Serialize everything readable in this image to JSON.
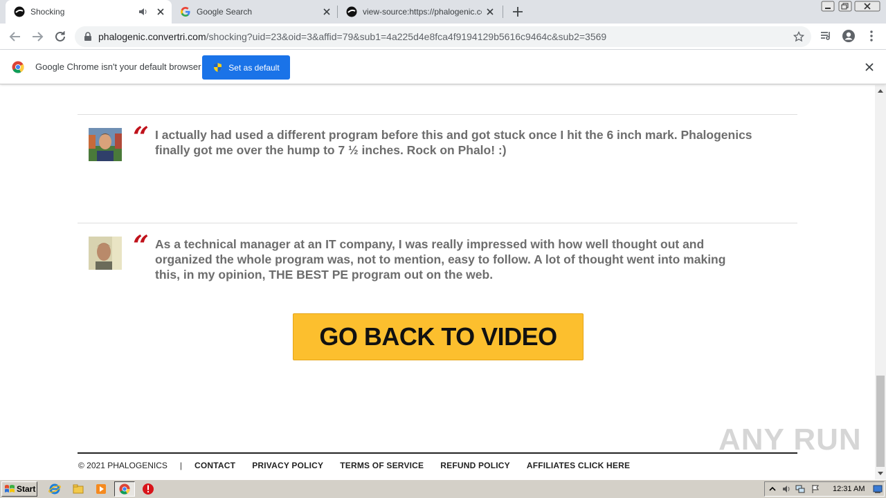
{
  "browser": {
    "tabs": [
      {
        "label": "Shocking",
        "active": true
      },
      {
        "label": "Google Search",
        "active": false
      },
      {
        "label": "view-source:https://phalogenic.conv",
        "active": false
      }
    ],
    "url": {
      "host": "phalogenic.convertri.com",
      "path": "/shocking?uid=23&oid=3&affid=79&sub1=4a225d4e8fca4f9194129b5616c9464c&sub2=3569"
    },
    "infobar": {
      "message": "Google Chrome isn't your default browser",
      "button_label": "Set as default"
    }
  },
  "testimonials": [
    {
      "quote_mark": "“",
      "text": "I actually had used a different program before this and got stuck once I hit the 6 inch mark. Phalogenics finally got me over the hump to 7 ½ inches. Rock on Phalo! :)"
    },
    {
      "quote_mark": "“",
      "text": "As a technical manager at an IT company, I was really impressed with how well thought out and organized the whole program was, not to mention, easy to follow. A lot of thought went into making this, in my opinion, THE BEST PE program out on the web."
    }
  ],
  "cta": {
    "label": "GO BACK TO VIDEO"
  },
  "footer": {
    "copyright": "© 2021  PHALOGENICS",
    "separator": "|",
    "links": [
      "CONTACT",
      "PRIVACY POLICY",
      "TERMS OF SERVICE",
      "REFUND POLICY",
      "AFFILIATES CLICK HERE"
    ]
  },
  "watermark": "ANY RUN",
  "taskbar": {
    "start_label": "Start",
    "clock": "12:31 AM"
  },
  "colors": {
    "accent_red": "#c0121b",
    "cta_yellow": "#fcbf2e",
    "chrome_blue": "#1a73e8"
  }
}
